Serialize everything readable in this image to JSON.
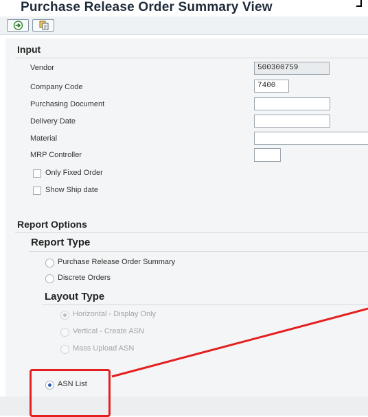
{
  "header": {
    "title": "Purchase Release Order Summary View"
  },
  "toolbar": {
    "buttons": [
      {
        "icon": "execute-icon"
      },
      {
        "icon": "copy-icon"
      }
    ]
  },
  "input_section": {
    "heading": "Input",
    "fields": [
      {
        "label": "Vendor",
        "value": "500300759",
        "readonly": true
      },
      {
        "label": "Company Code",
        "value": "7400"
      },
      {
        "label": "Purchasing Document",
        "value": ""
      },
      {
        "label": "Delivery Date",
        "value": ""
      },
      {
        "label": "Material",
        "value": ""
      },
      {
        "label": "MRP Controller",
        "value": ""
      }
    ],
    "checkboxes": [
      {
        "label": "Only Fixed Order",
        "checked": false
      },
      {
        "label": "Show Ship date",
        "checked": false
      }
    ]
  },
  "report_options": {
    "heading": "Report Options",
    "report_type": {
      "heading": "Report Type",
      "options": [
        {
          "label": "Purchase Release Order Summary",
          "selected": false
        },
        {
          "label": "Discrete Orders",
          "selected": false
        }
      ]
    },
    "layout_type": {
      "heading": "Layout Type",
      "options": [
        {
          "label": "Horizontal - Display Only",
          "selected": true,
          "disabled": true
        },
        {
          "label": "Vertical - Create ASN",
          "selected": false,
          "disabled": true
        },
        {
          "label": "Mass Upload ASN",
          "selected": false,
          "disabled": true
        }
      ]
    },
    "asn_list": {
      "label": "ASN List",
      "selected": true
    }
  },
  "colors": {
    "highlight": "#e41f1f",
    "panel": "#f4f5f6",
    "radio_selected": "#2b5fb3"
  }
}
